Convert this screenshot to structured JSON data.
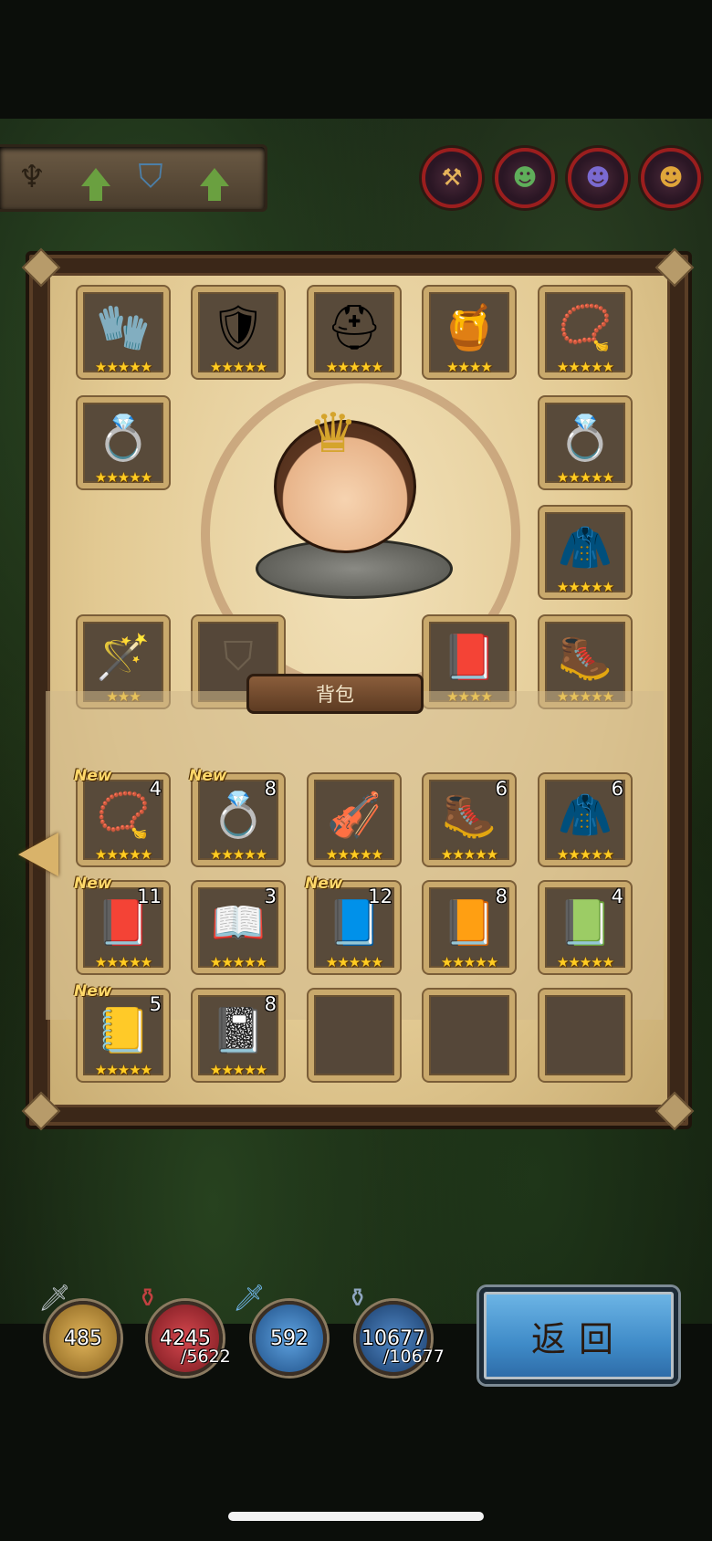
{
  "stars": {
    "five": "★★★★★",
    "four": "★★★★",
    "three": "★★★"
  },
  "equipped": [
    {
      "name": "gauntlet",
      "icon": "🧤",
      "stars": "★★★★★"
    },
    {
      "name": "armor",
      "icon": "🛡",
      "stars": "★★★★★"
    },
    {
      "name": "helmet",
      "icon": "⛑",
      "stars": "★★★★★"
    },
    {
      "name": "cauldron",
      "icon": "🍯",
      "stars": "★★★★"
    },
    {
      "name": "amulet",
      "icon": "📿",
      "stars": "★★★★★"
    },
    {
      "name": "bracelet",
      "icon": "💍",
      "stars": "★★★★★"
    },
    {
      "name": "ring",
      "icon": "💍",
      "stars": "★★★★★"
    },
    {
      "name": "cloak",
      "icon": "🧥",
      "stars": "★★★★★"
    },
    {
      "name": "scepter",
      "icon": "🪄",
      "stars": "★★★"
    },
    {
      "name": "book",
      "icon": "📕",
      "stars": "★★★★"
    },
    {
      "name": "boots",
      "icon": "🥾",
      "stars": "★★★★★"
    }
  ],
  "backpack": {
    "title": "背包",
    "items": [
      {
        "icon": "📿",
        "count": "4",
        "new": "New",
        "stars": "★★★★★"
      },
      {
        "icon": "💍",
        "count": "8",
        "new": "New",
        "stars": "★★★★★"
      },
      {
        "icon": "🎻",
        "count": "",
        "new": "",
        "stars": "★★★★★"
      },
      {
        "icon": "🥾",
        "count": "6",
        "new": "",
        "stars": "★★★★★"
      },
      {
        "icon": "🧥",
        "count": "6",
        "new": "",
        "stars": "★★★★★"
      },
      {
        "icon": "📕",
        "count": "11",
        "new": "New",
        "stars": "★★★★★"
      },
      {
        "icon": "📖",
        "count": "3",
        "new": "",
        "stars": "★★★★★"
      },
      {
        "icon": "📘",
        "count": "12",
        "new": "New",
        "stars": "★★★★★"
      },
      {
        "icon": "📙",
        "count": "8",
        "new": "",
        "stars": "★★★★★"
      },
      {
        "icon": "📗",
        "count": "4",
        "new": "",
        "stars": "★★★★★"
      },
      {
        "icon": "📒",
        "count": "5",
        "new": "New",
        "stars": "★★★★★"
      },
      {
        "icon": "📓",
        "count": "8",
        "new": "",
        "stars": "★★★★★"
      }
    ]
  },
  "resources": {
    "gold": {
      "value": "485",
      "color": "#c79a3a"
    },
    "hp": {
      "value": "4245",
      "max": "/5622",
      "color": "#b8333a"
    },
    "mana": {
      "value": "592",
      "color": "#3d84c9"
    },
    "exp": {
      "value": "10677",
      "max": "/10677",
      "color": "#2e66a8"
    }
  },
  "return_label": "返回"
}
